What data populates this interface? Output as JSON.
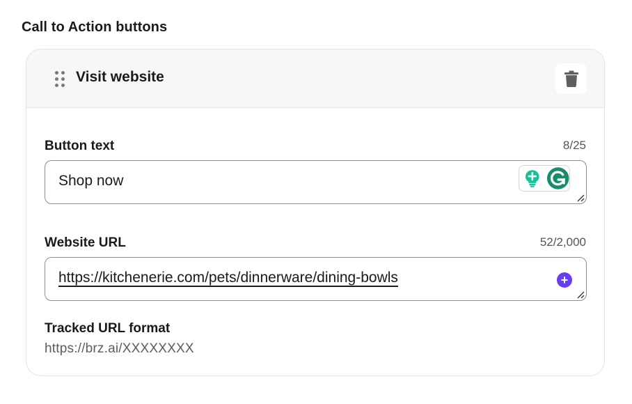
{
  "section": {
    "title": "Call to Action buttons"
  },
  "card": {
    "title": "Visit website",
    "drag_icon": "drag-handle-icon",
    "delete_icon": "trash-icon"
  },
  "button_text": {
    "label": "Button text",
    "counter": "8/25",
    "value": "Shop now"
  },
  "website_url": {
    "label": "Website URL",
    "counter": "52/2,000",
    "value": "https://kitchenerie.com/pets/dinnerware/dining-bowls",
    "add_icon": "plus-icon"
  },
  "tracked": {
    "label": "Tracked URL format",
    "value": "https://brz.ai/XXXXXXXX"
  },
  "colors": {
    "accent_purple": "#6a3cf0",
    "grammarly_green": "#15c39a",
    "grammarly_teal": "#1a8c6e"
  }
}
